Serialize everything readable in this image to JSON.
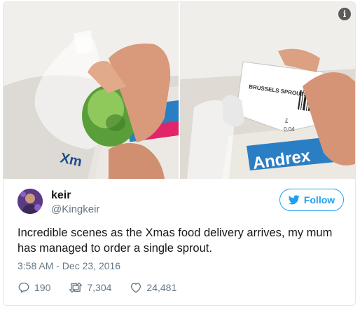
{
  "tweet": {
    "author": {
      "display_name": "keir",
      "handle": "@Kingkeir"
    },
    "follow_label": "Follow",
    "text": "Incredible scenes as the Xmas food delivery arrives, my mum has managed to order a single sprout.",
    "timestamp": "3:58 AM - Dec 23, 2016",
    "stats": {
      "replies": "190",
      "retweets": "7,304",
      "likes": "24,481"
    },
    "info_icon_glyph": "i"
  },
  "photos": {
    "right_label_text": "BRUSSELS SPROUTS",
    "right_price_currency": "£",
    "right_price_value": "0.04",
    "left_bag_text": "Xm",
    "right_bag_text": "Andrex"
  },
  "colors": {
    "accent": "#1da1f2",
    "secondary_text": "#657786",
    "primary_text": "#14171a",
    "border": "#e1e8ed"
  },
  "icons": {
    "info": "info-icon",
    "follow": "twitter-bird-icon",
    "reply": "reply-icon",
    "retweet": "retweet-icon",
    "like": "heart-icon"
  }
}
